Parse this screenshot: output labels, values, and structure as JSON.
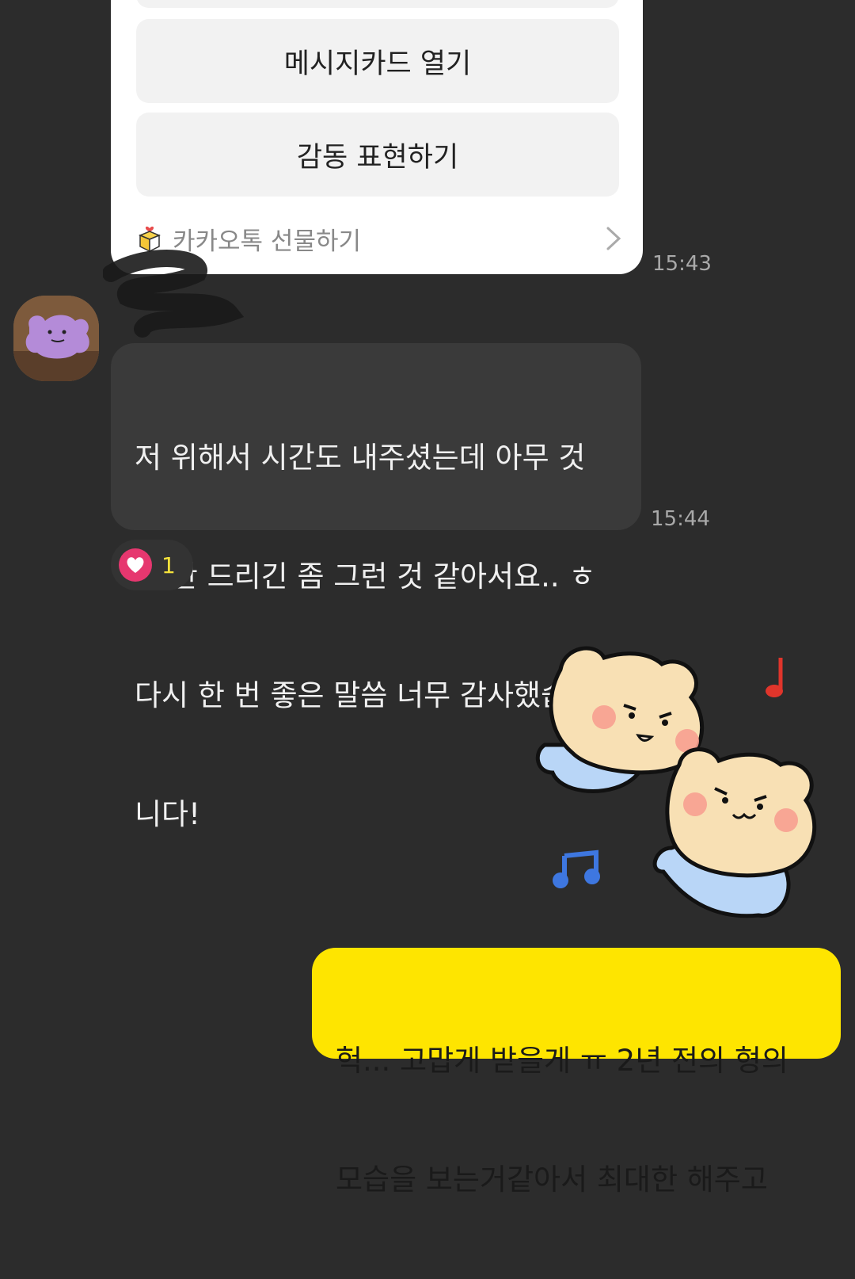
{
  "gift_card": {
    "buttons": [
      {
        "label": ""
      },
      {
        "label": "메시지카드 열기"
      },
      {
        "label": "감동 표현하기"
      }
    ],
    "footer_label": "카카오톡 선물하기",
    "time": "15:43"
  },
  "incoming": {
    "lines": [
      "저 위해서 시간도 내주셨는데 아무 것",
      "도 안 드리긴 좀 그런 것 같아서요.. ㅎ",
      "다시 한 번 좋은 말씀 너무 감사했습",
      "니다!"
    ],
    "time": "15:44",
    "reaction_count": "1"
  },
  "outgoing": {
    "lines": [
      "헉... 고맙게 받을게 ㅠ 2년 전의 형의",
      "모습을 보는거같아서 최대한 해주고"
    ]
  },
  "colors": {
    "background": "#2c2c2c",
    "incoming_bubble": "#3a3a3a",
    "outgoing_bubble": "#fee500",
    "heart": "#e6376f"
  }
}
